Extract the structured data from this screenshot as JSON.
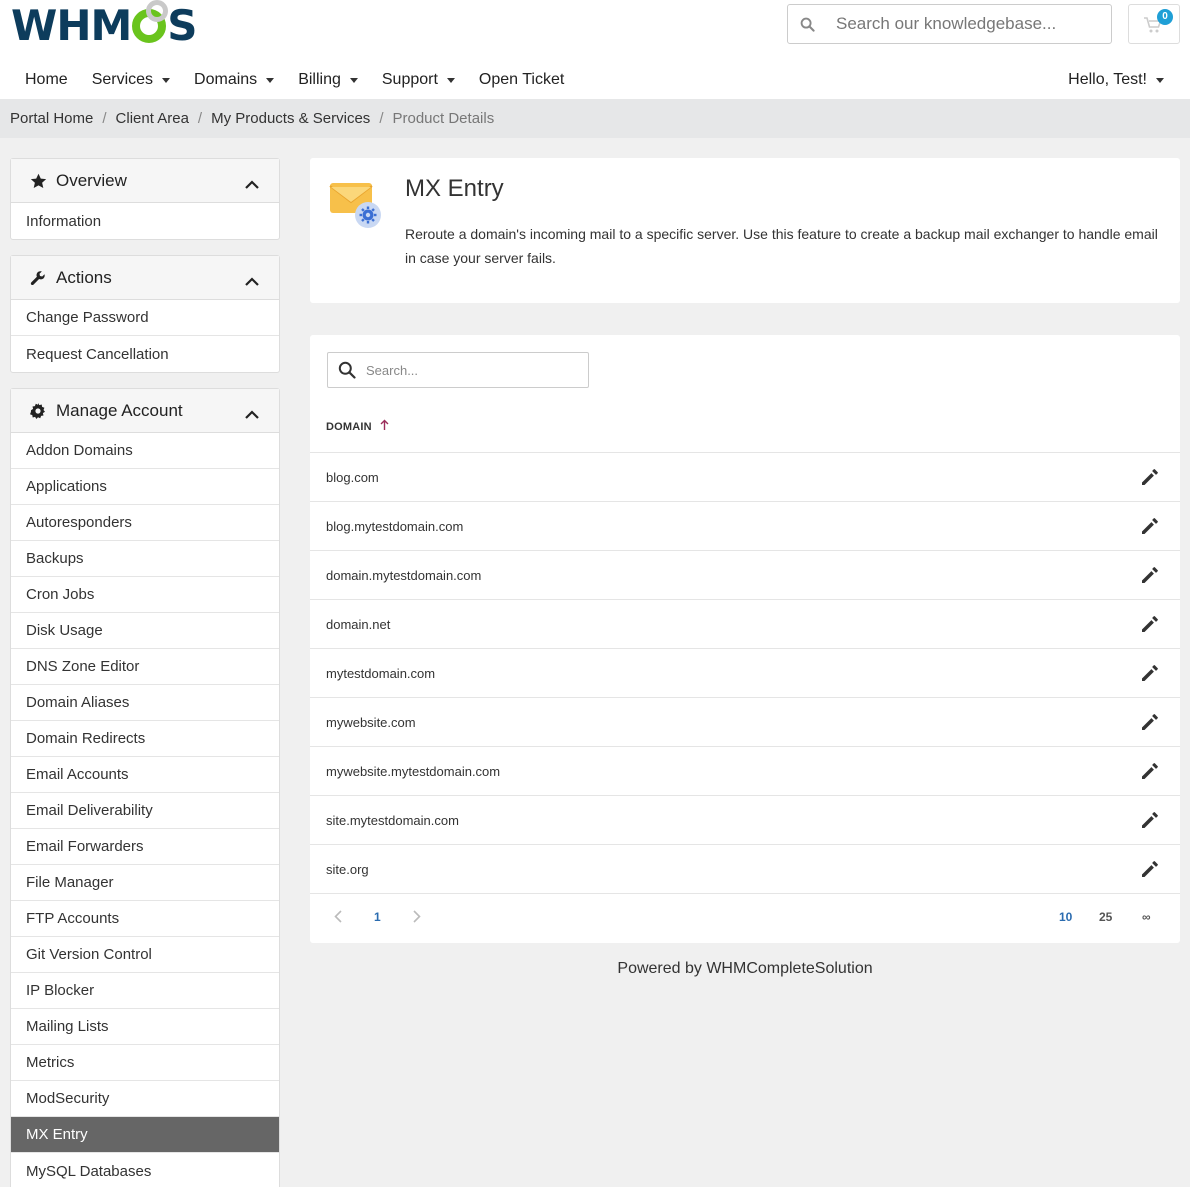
{
  "brand": {
    "logo_text_left": "WHM",
    "logo_text_right": "S"
  },
  "header": {
    "search_placeholder": "Search our knowledgebase...",
    "cart_count": "0"
  },
  "nav": {
    "items": [
      {
        "label": "Home",
        "dropdown": false
      },
      {
        "label": "Services",
        "dropdown": true
      },
      {
        "label": "Domains",
        "dropdown": true
      },
      {
        "label": "Billing",
        "dropdown": true
      },
      {
        "label": "Support",
        "dropdown": true
      },
      {
        "label": "Open Ticket",
        "dropdown": false
      }
    ],
    "user_label": "Hello, Test!"
  },
  "breadcrumb": {
    "items": [
      "Portal Home",
      "Client Area",
      "My Products & Services"
    ],
    "current": "Product Details"
  },
  "sidebar": {
    "overview": {
      "title": "Overview",
      "items": [
        "Information"
      ]
    },
    "actions": {
      "title": "Actions",
      "items": [
        "Change Password",
        "Request Cancellation"
      ]
    },
    "manage": {
      "title": "Manage Account",
      "items": [
        "Addon Domains",
        "Applications",
        "Autoresponders",
        "Backups",
        "Cron Jobs",
        "Disk Usage",
        "DNS Zone Editor",
        "Domain Aliases",
        "Domain Redirects",
        "Email Accounts",
        "Email Deliverability",
        "Email Forwarders",
        "File Manager",
        "FTP Accounts",
        "Git Version Control",
        "IP Blocker",
        "Mailing Lists",
        "Metrics",
        "ModSecurity",
        "MX Entry",
        "MySQL Databases"
      ],
      "active": "MX Entry"
    }
  },
  "page": {
    "title": "MX Entry",
    "description": "Reroute a domain's incoming mail to a specific server. Use this feature to create a backup mail exchanger to handle email in case your server fails."
  },
  "table": {
    "search_placeholder": "Search...",
    "column": "DOMAIN",
    "rows": [
      "blog.com",
      "blog.mytestdomain.com",
      "domain.mytestdomain.com",
      "domain.net",
      "mytestdomain.com",
      "mywebsite.com",
      "mywebsite.mytestdomain.com",
      "site.mytestdomain.com",
      "site.org"
    ],
    "page": "1",
    "page_sizes": [
      "10",
      "25",
      "∞"
    ],
    "active_page_size": "10"
  },
  "footer": {
    "text": "Powered by WHMCompleteSolution"
  },
  "colors": {
    "accent": "#2b6cb0",
    "logo_navy": "#0d3c5c",
    "logo_green": "#6ac41d",
    "active_item": "#666666"
  }
}
